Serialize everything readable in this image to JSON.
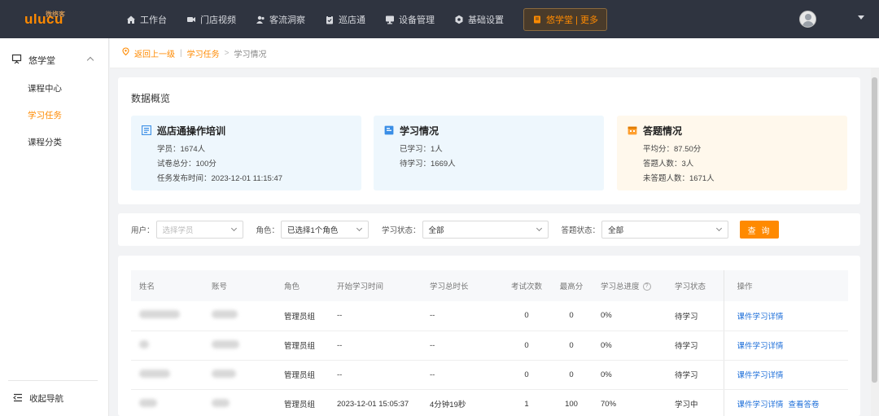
{
  "app": {
    "logo_cn": "微络客",
    "logo_word": "ulucu"
  },
  "nav": {
    "items": [
      {
        "label": "工作台",
        "icon": "home-icon"
      },
      {
        "label": "门店视频",
        "icon": "video-icon"
      },
      {
        "label": "客流洞察",
        "icon": "people-icon"
      },
      {
        "label": "巡店通",
        "icon": "clipboard-icon"
      },
      {
        "label": "设备管理",
        "icon": "device-icon"
      },
      {
        "label": "基础设置",
        "icon": "settings-icon"
      },
      {
        "label": "悠学堂 | 更多",
        "icon": "book-icon"
      }
    ]
  },
  "sidebar": {
    "group_label": "悠学堂",
    "items": [
      {
        "label": "课程中心"
      },
      {
        "label": "学习任务"
      },
      {
        "label": "课程分类"
      }
    ],
    "collapse_label": "收起导航"
  },
  "breadcrumb": {
    "back": "返回上一级",
    "sep": "|",
    "parent": "学习任务",
    "arrow": ">",
    "current": "学习情况"
  },
  "overview": {
    "title": "数据概览",
    "cards": [
      {
        "title": "巡店通操作培训",
        "lines": [
          "学员：1674人",
          "试卷总分：100分",
          "任务发布时间：2023-12-01 11:15:47"
        ],
        "bg": "#eef7fd"
      },
      {
        "title": "学习情况",
        "lines": [
          "已学习：1人",
          "待学习：1669人"
        ],
        "bg": "#eef7fd"
      },
      {
        "title": "答题情况",
        "lines": [
          "平均分：87.50分",
          "答题人数：3人",
          "未答题人数：1671人"
        ],
        "bg": "#fff8ec"
      }
    ]
  },
  "filters": {
    "user_label": "用户：",
    "user_placeholder": "选择学员",
    "role_label": "角色：",
    "role_value": "已选择1个角色",
    "study_label": "学习状态：",
    "study_value": "全部",
    "answer_label": "答题状态：",
    "answer_value": "全部",
    "query_label": "查 询"
  },
  "table": {
    "headers": [
      "姓名",
      "账号",
      "角色",
      "开始学习时间",
      "学习总时长",
      "考试次数",
      "最高分",
      "学习总进度",
      "学习状态",
      "操作"
    ],
    "help_glyph": "?",
    "rows": [
      {
        "role": "管理员组",
        "start": "--",
        "duration": "--",
        "exams": "0",
        "top": "0",
        "progress": "0%",
        "status": "待学习",
        "ops": [
          "课件学习详情"
        ]
      },
      {
        "role": "管理员组",
        "start": "--",
        "duration": "--",
        "exams": "0",
        "top": "0",
        "progress": "0%",
        "status": "待学习",
        "ops": [
          "课件学习详情"
        ]
      },
      {
        "role": "管理员组",
        "start": "--",
        "duration": "--",
        "exams": "0",
        "top": "0",
        "progress": "0%",
        "status": "待学习",
        "ops": [
          "课件学习详情"
        ]
      },
      {
        "role": "管理员组",
        "start": "2023-12-01 15:05:37",
        "duration": "4分钟19秒",
        "exams": "1",
        "top": "100",
        "progress": "70%",
        "status": "学习中",
        "ops": [
          "课件学习详情",
          "查看答卷"
        ]
      }
    ]
  },
  "colors": {
    "accent": "#ff8a00",
    "link": "#1e6fd9",
    "topbar": "#2f3440"
  }
}
